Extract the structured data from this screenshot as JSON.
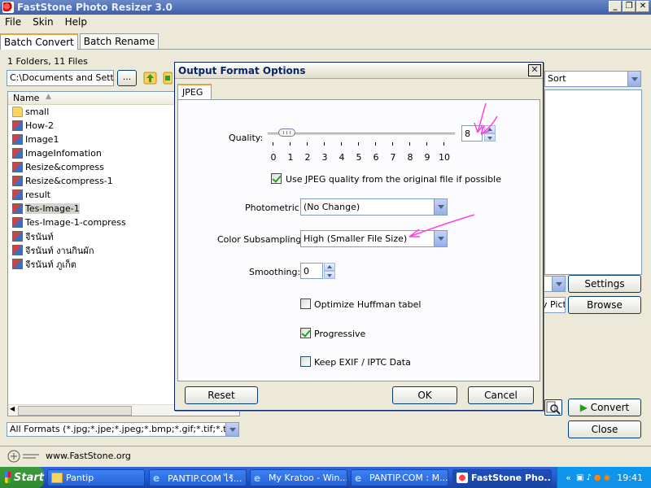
{
  "window": {
    "title": "FastStone Photo Resizer 3.0"
  },
  "menu": [
    "File",
    "Skin",
    "Help"
  ],
  "main_tabs": [
    "Batch Convert",
    "Batch Rename"
  ],
  "left": {
    "folder_count": "1 Folders, 11 Files",
    "path": "C:\\Documents and Settings",
    "browse_label": "...",
    "column_name": "Name",
    "files": [
      {
        "name": "small",
        "type": "folder"
      },
      {
        "name": "How-2",
        "type": "image"
      },
      {
        "name": "Image1",
        "type": "image"
      },
      {
        "name": "ImageInfomation",
        "type": "image"
      },
      {
        "name": "Resize&compress",
        "type": "image"
      },
      {
        "name": "Resize&compress-1",
        "type": "image"
      },
      {
        "name": "result",
        "type": "image"
      },
      {
        "name": "Tes-Image-1",
        "type": "image",
        "selected": true
      },
      {
        "name": "Tes-Image-1-compress",
        "type": "image"
      },
      {
        "name": "จีรนันท์",
        "type": "image"
      },
      {
        "name": "จีรนันท์ งานกินผัก",
        "type": "image"
      },
      {
        "name": "จีรนันท์ ภูเก็ต",
        "type": "image"
      }
    ],
    "formats": "All Formats (*.jpg;*.jpe;*.jpeg;*.bmp;*.gif;*.tif;*.tiff;*"
  },
  "right": {
    "sort": "Sort",
    "pict_field": "y Pict",
    "settings_label": "Settings",
    "browse_label": "Browse",
    "convert_label": "Convert",
    "close_label": "Close"
  },
  "status": {
    "url": "www.FastStone.org"
  },
  "dialog": {
    "title": "Output Format Options",
    "close_glyph": "✕",
    "tab": "JPEG",
    "quality_label": "Quality:",
    "quality_value": "8",
    "quality_min": 0,
    "quality_max": 10,
    "slider_level": 0.08,
    "ticks": [
      "0",
      "1",
      "2",
      "3",
      "4",
      "5",
      "6",
      "7",
      "8",
      "9",
      "10"
    ],
    "use_original_label": "Use JPEG quality from the original file if possible",
    "use_original_checked": true,
    "photometric_label": "Photometric:",
    "photometric_value": "(No Change)",
    "subsampling_label": "Color Subsampling:",
    "subsampling_value": "High (Smaller File Size)",
    "smoothing_label": "Smoothing:",
    "smoothing_value": "0",
    "optimize_label": "Optimize Huffman tabel",
    "optimize_checked": false,
    "progressive_label": "Progressive",
    "progressive_checked": true,
    "exif_label": "Keep EXIF / IPTC Data",
    "exif_checked": false,
    "reset_label": "Reset",
    "ok_label": "OK",
    "cancel_label": "Cancel",
    "annotation_color": "#ff44dd"
  },
  "taskbar": {
    "start": "Start",
    "items": [
      {
        "label": "Pantip"
      },
      {
        "label": "PANTIP.COM ไร้..."
      },
      {
        "label": "My Kratoo - Win..."
      },
      {
        "label": "PANTIP.COM : M..."
      },
      {
        "label": "FastStone Pho...",
        "active": true
      }
    ],
    "tray_chevron": "«",
    "clock": "19:41"
  }
}
